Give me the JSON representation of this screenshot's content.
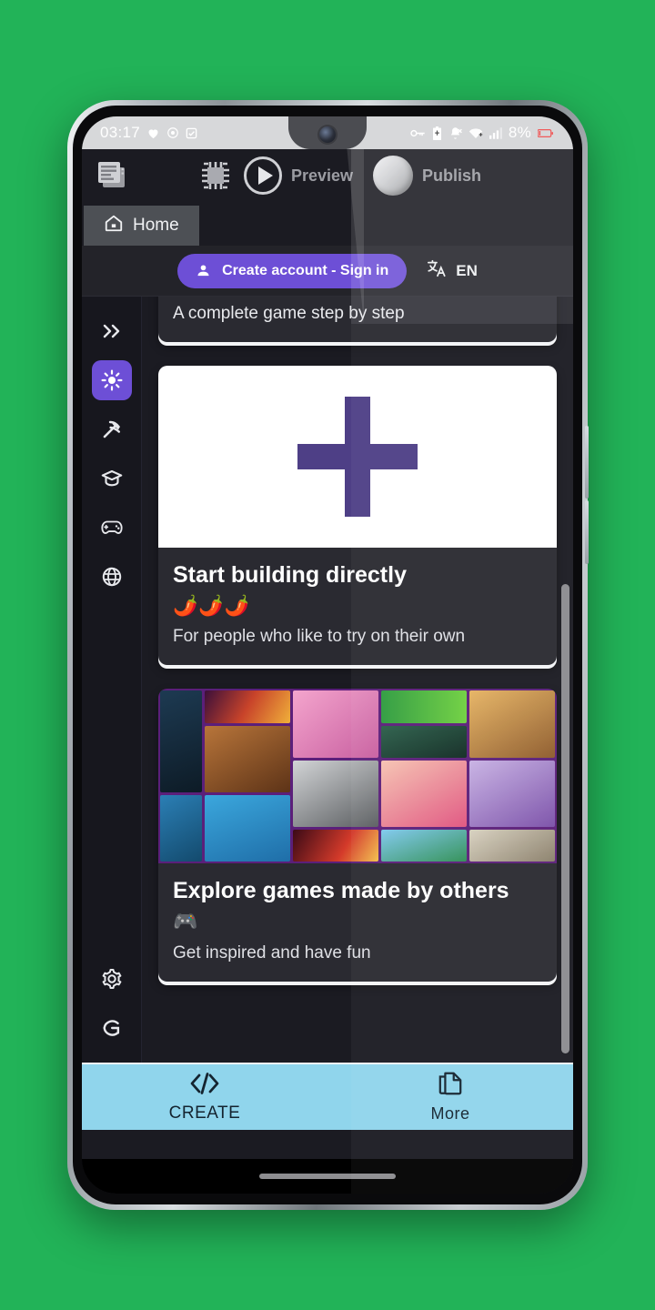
{
  "background_color": "#22b358",
  "status_bar": {
    "clock": "03:17",
    "left_icons": [
      "heart-icon",
      "target-icon",
      "checkbox-icon"
    ],
    "right_icons": [
      "vpn-key-icon",
      "battery-saver-icon",
      "bell-muted-icon",
      "wifi-icon",
      "cell-signal-icon"
    ],
    "battery_percent": "8%"
  },
  "toolbar": {
    "pages_icon": "stacked-pages-icon",
    "chip_icon": "cpu-chip-icon",
    "preview_label": "Preview",
    "publish_label": "Publish"
  },
  "tabs": {
    "home_label": "Home",
    "home_icon": "home-icon"
  },
  "account_bar": {
    "button_label": "Create account - Sign in",
    "button_icon": "person-icon",
    "button_color": "#6d4fd6",
    "language_label": "EN",
    "language_icon": "translate-icon"
  },
  "sidebar": {
    "items": [
      {
        "name": "expand",
        "icon": "double-chevron-right-icon",
        "active": false
      },
      {
        "name": "magic",
        "icon": "sun-sparkle-icon",
        "active": true
      },
      {
        "name": "build",
        "icon": "pickaxe-icon",
        "active": false
      },
      {
        "name": "learn",
        "icon": "graduation-cap-icon",
        "active": false
      },
      {
        "name": "games",
        "icon": "gamepad-icon",
        "active": false
      },
      {
        "name": "community",
        "icon": "globe-icon",
        "active": false
      }
    ],
    "bottom_items": [
      {
        "name": "settings",
        "icon": "gear-icon"
      },
      {
        "name": "gdevelop-logo",
        "icon": "g-logo-icon"
      }
    ]
  },
  "cards": [
    {
      "id": "tutorial-card",
      "subtitle_only": "A complete game step by step"
    },
    {
      "id": "start-building-card",
      "media": "plus-sign",
      "title": "Start building directly",
      "emoji": "🌶️🌶️🌶️",
      "description": "For people who like to try on their own"
    },
    {
      "id": "explore-games-card",
      "media": "games-collage",
      "title": "Explore games made by others",
      "emoji": "🎮",
      "description": "Get inspired and have fun"
    }
  ],
  "bottom_nav": [
    {
      "label": "CREATE",
      "icon": "code-brackets-icon"
    },
    {
      "label": "More",
      "icon": "copy-documents-icon"
    }
  ],
  "colors": {
    "accent_purple": "#6d4fd6",
    "bottom_nav_blue": "#90d5ec",
    "card_bg": "#2a2a31",
    "app_bg": "#1b1b22",
    "sidebar_bg": "#17171e",
    "collage_border": "#5b1f7a"
  }
}
